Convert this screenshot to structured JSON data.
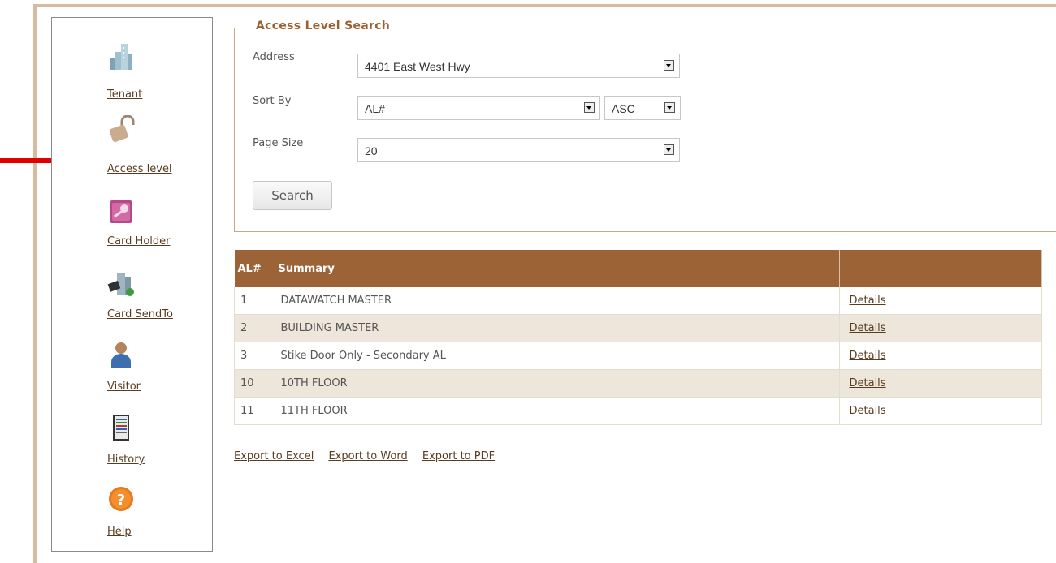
{
  "sidebar": {
    "items": [
      {
        "label": "Tenant",
        "icon": "building-icon"
      },
      {
        "label": "Access level",
        "icon": "padlock-icon"
      },
      {
        "label": "Card Holder",
        "icon": "key-card-icon"
      },
      {
        "label": "Card SendTo",
        "icon": "building-card-icon"
      },
      {
        "label": "Visitor",
        "icon": "person-icon"
      },
      {
        "label": "History",
        "icon": "notebook-icon"
      },
      {
        "label": "Help",
        "icon": "help-icon"
      }
    ]
  },
  "search": {
    "legend": "Access Level Search",
    "address_label": "Address",
    "address_value": "4401 East West Hwy",
    "sortby_label": "Sort By",
    "sortby_value": "AL#",
    "sortdir_value": "ASC",
    "pagesize_label": "Page Size",
    "pagesize_value": "20",
    "search_button": "Search"
  },
  "table": {
    "headers": [
      "AL#",
      "Summary",
      ""
    ],
    "rows": [
      {
        "al": "1",
        "summary": "DATAWATCH MASTER",
        "link": "Details"
      },
      {
        "al": "2",
        "summary": "BUILDING MASTER",
        "link": "Details"
      },
      {
        "al": "3",
        "summary": "Stike Door Only - Secondary AL",
        "link": "Details"
      },
      {
        "al": "10",
        "summary": "10TH FLOOR",
        "link": "Details"
      },
      {
        "al": "11",
        "summary": "11TH FLOOR",
        "link": "Details"
      }
    ]
  },
  "exports": {
    "excel": "Export to Excel",
    "word": "Export to Word",
    "pdf": "Export to PDF"
  },
  "colors": {
    "header": "#9b6336",
    "frame": "#d7bb9e",
    "link": "#5a3d20",
    "arrow": "#e00000"
  }
}
